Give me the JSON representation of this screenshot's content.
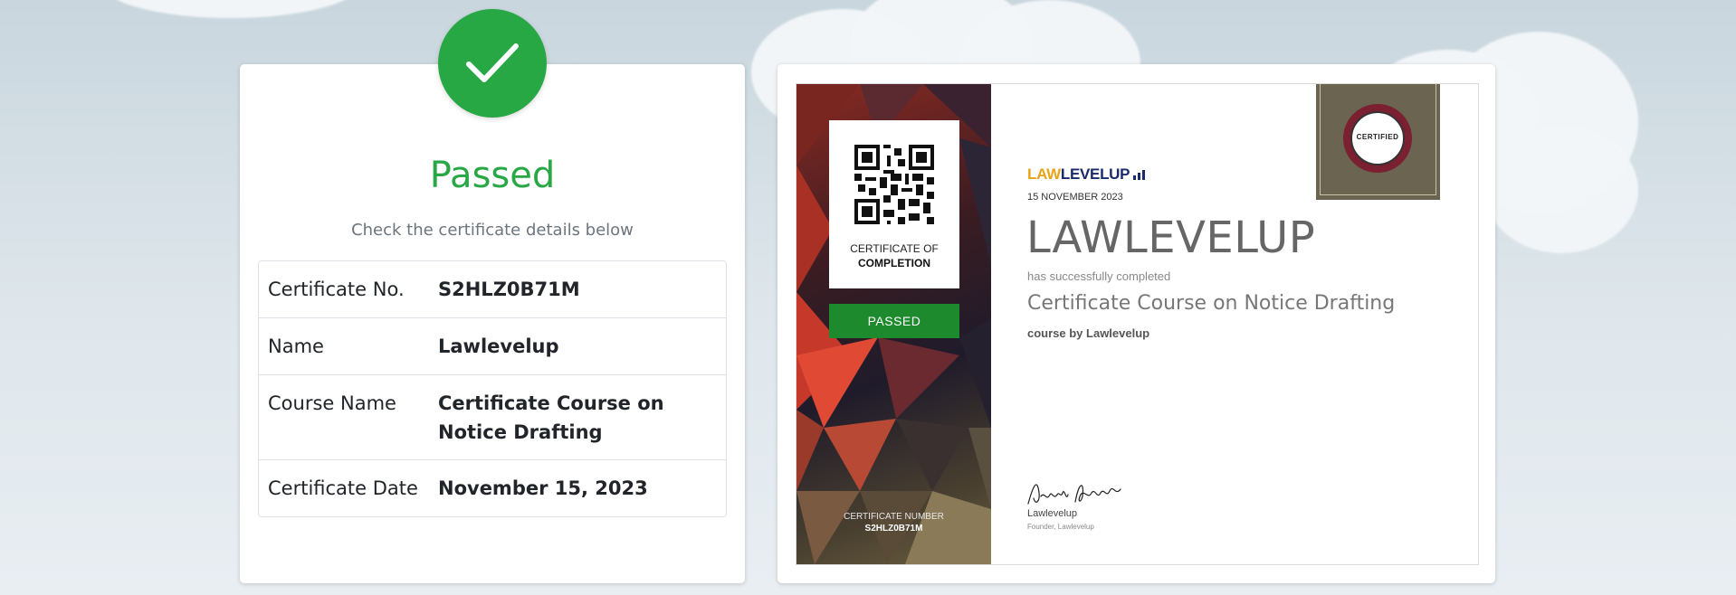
{
  "status": {
    "title": "Passed",
    "subtitle": "Check the certificate details below",
    "badge_icon": "checkmark-icon",
    "color": "#28a745"
  },
  "details": {
    "rows": [
      {
        "label": "Certificate No.",
        "value": "S2HLZ0B71M"
      },
      {
        "label": "Name",
        "value": "Lawlevelup"
      },
      {
        "label": "Course Name",
        "value": "Certificate Course on Notice Drafting"
      },
      {
        "label": "Certificate Date",
        "value": "November 15, 2023"
      }
    ]
  },
  "certificate": {
    "qr_caption_line1": "CERTIFICATE OF",
    "qr_caption_line2": "COMPLETION",
    "passed_label": "PASSED",
    "cert_number_label": "CERTIFICATE NUMBER",
    "cert_number": "S2HLZ0B71M",
    "brand_part1": "LAW",
    "brand_part2": "LEVELUP",
    "date": "15 NOVEMBER 2023",
    "recipient": "LAWLEVELUP",
    "completed_text": "has successfully completed",
    "course_title": "Certificate Course on Notice Drafting",
    "course_by": "course by Lawlevelup",
    "seal_text": "CERTIFIED",
    "signer_name": "Lawlevelup",
    "signer_role": "Founder, Lawlevelup",
    "passed_color": "#1e8a2e",
    "brand_color_1": "#e8a317",
    "brand_color_2": "#1a2a6c"
  }
}
